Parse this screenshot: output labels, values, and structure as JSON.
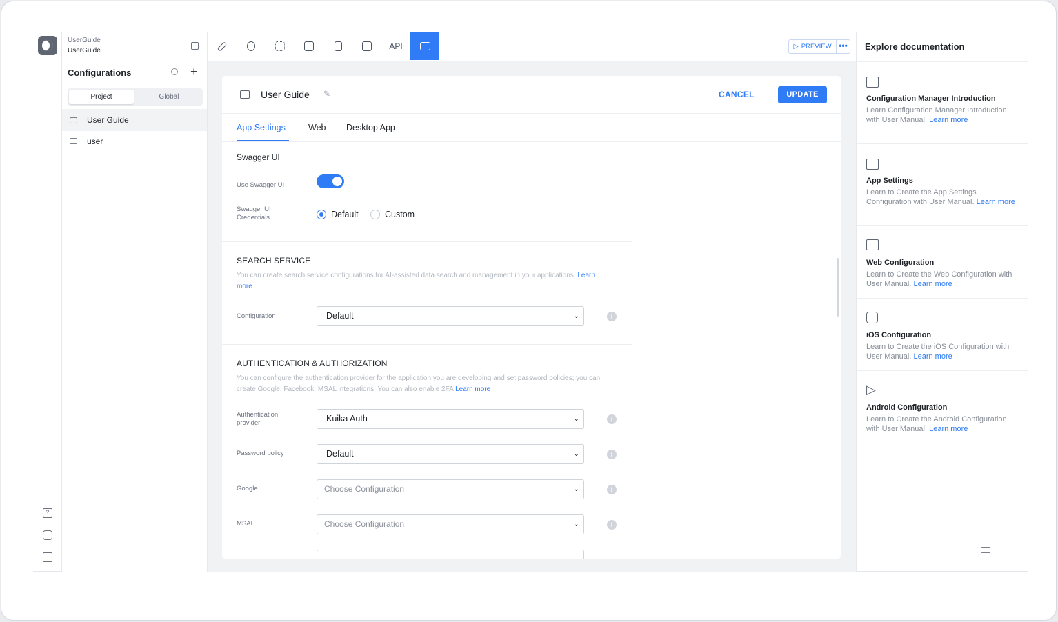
{
  "project": {
    "name": "UserGuide",
    "subname": "UserGuide"
  },
  "configurations": {
    "title": "Configurations",
    "segments": [
      "Project",
      "Global"
    ],
    "items": [
      "User Guide",
      "user"
    ]
  },
  "toolbar": {
    "api_label": "API",
    "preview_label": "PREVIEW",
    "more_label": "•••"
  },
  "editor": {
    "title": "User Guide",
    "cancel_label": "CANCEL",
    "update_label": "UPDATE",
    "tabs": [
      "App Settings",
      "Web",
      "Desktop App"
    ]
  },
  "swagger": {
    "title": "Swagger UI",
    "use_label": "Use Swagger UI",
    "use_enabled": true,
    "credentials_label": "Swagger UI Credentials",
    "options": [
      "Default",
      "Custom"
    ],
    "selected": "Default"
  },
  "search_service": {
    "title": "SEARCH SERVICE",
    "description": "You can create search service configurations for AI-assisted data search and management in your applications.",
    "learn_more": "Learn more",
    "config_label": "Configuration",
    "config_value": "Default"
  },
  "auth": {
    "title": "AUTHENTICATION & AUTHORIZATION",
    "description": "You can configure the authentication provider for the application you are developing and set password policies; you can create Google, Facebook, MSAL integrations. You can also enable 2FA",
    "learn_more": "Learn more",
    "provider_label": "Authentication provider",
    "provider_value": "Kuika Auth",
    "password_label": "Password policy",
    "password_value": "Default",
    "google_label": "Google",
    "google_placeholder": "Choose Configuration",
    "msal_label": "MSAL",
    "msal_placeholder": "Choose Configuration"
  },
  "docs": {
    "title": "Explore documentation",
    "items": [
      {
        "icon": "config-window-icon",
        "title": "Configuration Manager Introduction",
        "desc": "Learn Configuration Manager Introduction with User Manual.",
        "link": "Learn more"
      },
      {
        "icon": "config-window-icon",
        "title": "App Settings",
        "desc": "Learn to Create the App Settings Configuration with User Manual.",
        "link": "Learn more"
      },
      {
        "icon": "web-grid-icon",
        "title": "Web Configuration",
        "desc": "Learn to Create the Web Configuration with User Manual.",
        "link": "Learn more"
      },
      {
        "icon": "app-store-icon",
        "title": "iOS Configuration",
        "desc": "Learn to Create the iOS Configuration with User Manual.",
        "link": "Learn more"
      },
      {
        "icon": "play-store-icon",
        "title": "Android Configuration",
        "desc": "Learn to Create the Android Configuration with User Manual.",
        "link": "Learn more"
      }
    ]
  },
  "colors": {
    "accent": "#2f7cf6",
    "muted_text": "#8a9099"
  }
}
